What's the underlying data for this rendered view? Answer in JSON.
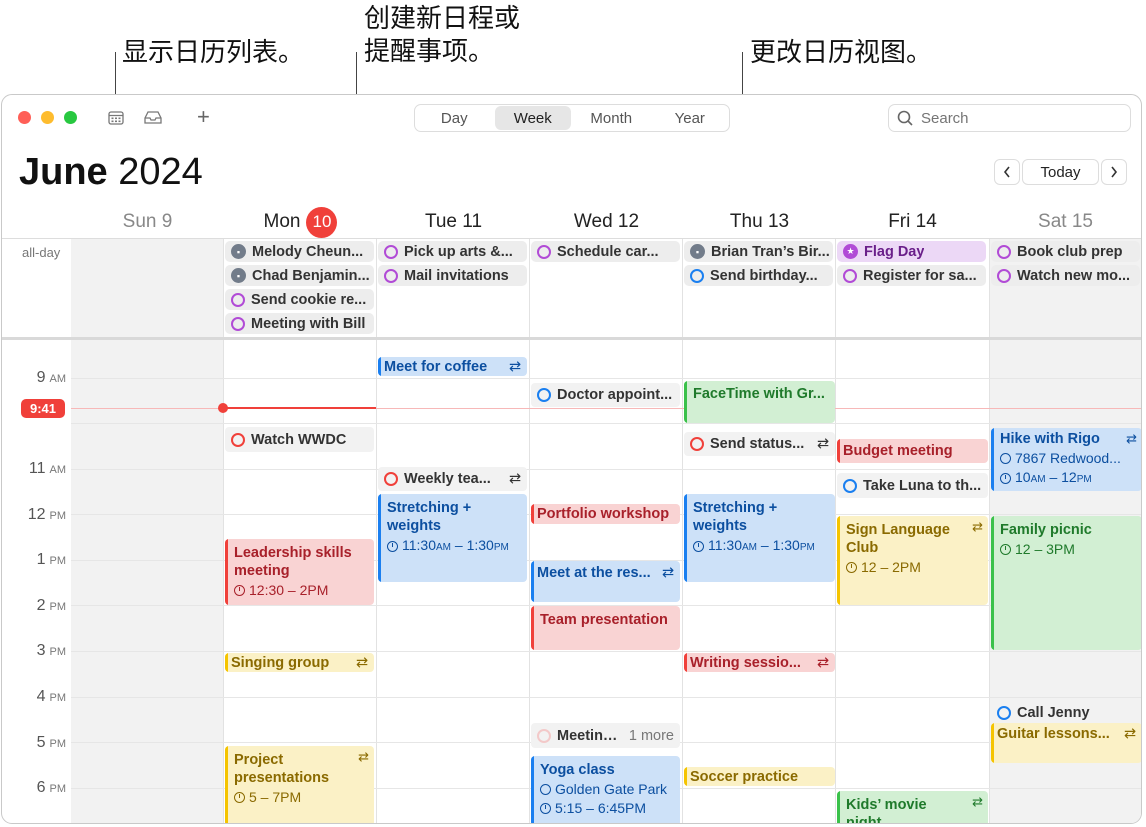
{
  "annotations": {
    "calendar_list": "显示日历列表。",
    "new_event_line1": "创建新日程或",
    "new_event_line2": "提醒事项。",
    "change_view": "更改日历视图。"
  },
  "toolbar": {
    "add_label": "+",
    "view_tabs": [
      "Day",
      "Week",
      "Month",
      "Year"
    ],
    "selected_tab": "Week",
    "search_placeholder": "Search"
  },
  "header": {
    "month": "June",
    "year": "2024",
    "today_label": "Today",
    "prev_icon": "chevron-left",
    "next_icon": "chevron-right"
  },
  "days": [
    {
      "name": "Sun 9"
    },
    {
      "name": "Mon",
      "badge": "10"
    },
    {
      "name": "Tue 11"
    },
    {
      "name": "Wed 12"
    },
    {
      "name": "Thu 13"
    },
    {
      "name": "Fri 14"
    },
    {
      "name": "Sat 15"
    }
  ],
  "allday": {
    "label": "all-day",
    "mon": [
      "Melody Cheun...",
      "Chad Benjamin...",
      "Send cookie re...",
      "Meeting with Bill"
    ],
    "tue": [
      "Pick up arts &...",
      "Mail invitations"
    ],
    "wed": [
      "Schedule car..."
    ],
    "thu": [
      "Brian Tran’s Bir...",
      "Send birthday..."
    ],
    "fri": [
      "Flag Day",
      "Register for sa..."
    ],
    "sat": [
      "Book club prep",
      "Watch new mo..."
    ]
  },
  "hours": [
    {
      "h": "9",
      "ap": "AM"
    },
    {
      "h": "11",
      "ap": "AM"
    },
    {
      "h": "12",
      "ap": "PM"
    },
    {
      "h": "1",
      "ap": "PM"
    },
    {
      "h": "2",
      "ap": "PM"
    },
    {
      "h": "3",
      "ap": "PM"
    },
    {
      "h": "4",
      "ap": "PM"
    },
    {
      "h": "5",
      "ap": "PM"
    },
    {
      "h": "6",
      "ap": "PM"
    }
  ],
  "current_time": "9:41",
  "events": {
    "meet_coffee": "Meet for coffee",
    "doctor": "Doctor appoint...",
    "facetime": "FaceTime with Gr...",
    "watch_wwdc": "Watch WWDC",
    "send_status": "Send status...",
    "budget": "Budget meeting",
    "hike": "Hike with Rigo",
    "hike_loc": "7867 Redwood...",
    "hike_time_a": "10",
    "hike_time_b": "AM",
    "hike_time_c": " – 12",
    "hike_time_d": "PM",
    "weekly": "Weekly tea...",
    "take_luna": "Take Luna to th...",
    "stretch": "Stretching + weights",
    "stretch_time_a": "11:30",
    "stretch_time_b": "AM",
    "stretch_time_c": " – 1:30",
    "stretch_time_d": "PM",
    "portfolio": "Portfolio workshop",
    "sign_lang": "Sign Language Club",
    "sign_time": "12 – 2PM",
    "family": "Family picnic",
    "family_time": "12 – 3PM",
    "leadership": "Leadership skills meeting",
    "leadership_time": "12:30 – 2PM",
    "meet_res": "Meet at the res...",
    "team_pres": "Team presentation",
    "singing": "Singing group",
    "writing": "Writing sessio...",
    "call_jenny": "Call Jenny",
    "guitar": "Guitar lessons...",
    "meeting_more": "Meeting...",
    "more_label": "1 more",
    "project": "Project presentations",
    "project_time": "5 – 7PM",
    "yoga": "Yoga class",
    "yoga_loc": "Golden Gate Park",
    "yoga_time": "5:15 – 6:45PM",
    "soccer": "Soccer practice",
    "kids_movie": "Kids’ movie night"
  },
  "colors": {
    "blue": "#1a7ff0",
    "red": "#f0403a",
    "yellow": "#f5c400",
    "green": "#3ac14a",
    "purple": "#b14bd6",
    "gray": "#727c8a"
  }
}
